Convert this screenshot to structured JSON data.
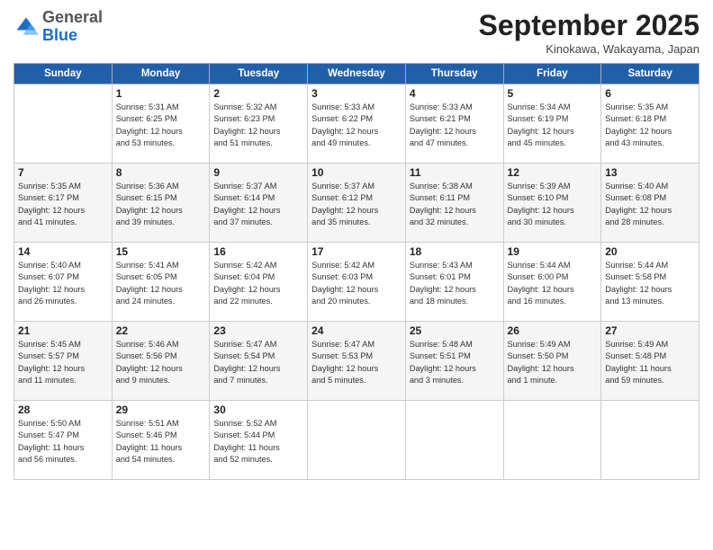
{
  "header": {
    "logo_general": "General",
    "logo_blue": "Blue",
    "month_title": "September 2025",
    "location": "Kinokawa, Wakayama, Japan"
  },
  "weekdays": [
    "Sunday",
    "Monday",
    "Tuesday",
    "Wednesday",
    "Thursday",
    "Friday",
    "Saturday"
  ],
  "weeks": [
    [
      {
        "day": "",
        "info": ""
      },
      {
        "day": "1",
        "info": "Sunrise: 5:31 AM\nSunset: 6:25 PM\nDaylight: 12 hours\nand 53 minutes."
      },
      {
        "day": "2",
        "info": "Sunrise: 5:32 AM\nSunset: 6:23 PM\nDaylight: 12 hours\nand 51 minutes."
      },
      {
        "day": "3",
        "info": "Sunrise: 5:33 AM\nSunset: 6:22 PM\nDaylight: 12 hours\nand 49 minutes."
      },
      {
        "day": "4",
        "info": "Sunrise: 5:33 AM\nSunset: 6:21 PM\nDaylight: 12 hours\nand 47 minutes."
      },
      {
        "day": "5",
        "info": "Sunrise: 5:34 AM\nSunset: 6:19 PM\nDaylight: 12 hours\nand 45 minutes."
      },
      {
        "day": "6",
        "info": "Sunrise: 5:35 AM\nSunset: 6:18 PM\nDaylight: 12 hours\nand 43 minutes."
      }
    ],
    [
      {
        "day": "7",
        "info": "Sunrise: 5:35 AM\nSunset: 6:17 PM\nDaylight: 12 hours\nand 41 minutes."
      },
      {
        "day": "8",
        "info": "Sunrise: 5:36 AM\nSunset: 6:15 PM\nDaylight: 12 hours\nand 39 minutes."
      },
      {
        "day": "9",
        "info": "Sunrise: 5:37 AM\nSunset: 6:14 PM\nDaylight: 12 hours\nand 37 minutes."
      },
      {
        "day": "10",
        "info": "Sunrise: 5:37 AM\nSunset: 6:12 PM\nDaylight: 12 hours\nand 35 minutes."
      },
      {
        "day": "11",
        "info": "Sunrise: 5:38 AM\nSunset: 6:11 PM\nDaylight: 12 hours\nand 32 minutes."
      },
      {
        "day": "12",
        "info": "Sunrise: 5:39 AM\nSunset: 6:10 PM\nDaylight: 12 hours\nand 30 minutes."
      },
      {
        "day": "13",
        "info": "Sunrise: 5:40 AM\nSunset: 6:08 PM\nDaylight: 12 hours\nand 28 minutes."
      }
    ],
    [
      {
        "day": "14",
        "info": "Sunrise: 5:40 AM\nSunset: 6:07 PM\nDaylight: 12 hours\nand 26 minutes."
      },
      {
        "day": "15",
        "info": "Sunrise: 5:41 AM\nSunset: 6:05 PM\nDaylight: 12 hours\nand 24 minutes."
      },
      {
        "day": "16",
        "info": "Sunrise: 5:42 AM\nSunset: 6:04 PM\nDaylight: 12 hours\nand 22 minutes."
      },
      {
        "day": "17",
        "info": "Sunrise: 5:42 AM\nSunset: 6:03 PM\nDaylight: 12 hours\nand 20 minutes."
      },
      {
        "day": "18",
        "info": "Sunrise: 5:43 AM\nSunset: 6:01 PM\nDaylight: 12 hours\nand 18 minutes."
      },
      {
        "day": "19",
        "info": "Sunrise: 5:44 AM\nSunset: 6:00 PM\nDaylight: 12 hours\nand 16 minutes."
      },
      {
        "day": "20",
        "info": "Sunrise: 5:44 AM\nSunset: 5:58 PM\nDaylight: 12 hours\nand 13 minutes."
      }
    ],
    [
      {
        "day": "21",
        "info": "Sunrise: 5:45 AM\nSunset: 5:57 PM\nDaylight: 12 hours\nand 11 minutes."
      },
      {
        "day": "22",
        "info": "Sunrise: 5:46 AM\nSunset: 5:56 PM\nDaylight: 12 hours\nand 9 minutes."
      },
      {
        "day": "23",
        "info": "Sunrise: 5:47 AM\nSunset: 5:54 PM\nDaylight: 12 hours\nand 7 minutes."
      },
      {
        "day": "24",
        "info": "Sunrise: 5:47 AM\nSunset: 5:53 PM\nDaylight: 12 hours\nand 5 minutes."
      },
      {
        "day": "25",
        "info": "Sunrise: 5:48 AM\nSunset: 5:51 PM\nDaylight: 12 hours\nand 3 minutes."
      },
      {
        "day": "26",
        "info": "Sunrise: 5:49 AM\nSunset: 5:50 PM\nDaylight: 12 hours\nand 1 minute."
      },
      {
        "day": "27",
        "info": "Sunrise: 5:49 AM\nSunset: 5:48 PM\nDaylight: 11 hours\nand 59 minutes."
      }
    ],
    [
      {
        "day": "28",
        "info": "Sunrise: 5:50 AM\nSunset: 5:47 PM\nDaylight: 11 hours\nand 56 minutes."
      },
      {
        "day": "29",
        "info": "Sunrise: 5:51 AM\nSunset: 5:46 PM\nDaylight: 11 hours\nand 54 minutes."
      },
      {
        "day": "30",
        "info": "Sunrise: 5:52 AM\nSunset: 5:44 PM\nDaylight: 11 hours\nand 52 minutes."
      },
      {
        "day": "",
        "info": ""
      },
      {
        "day": "",
        "info": ""
      },
      {
        "day": "",
        "info": ""
      },
      {
        "day": "",
        "info": ""
      }
    ]
  ]
}
